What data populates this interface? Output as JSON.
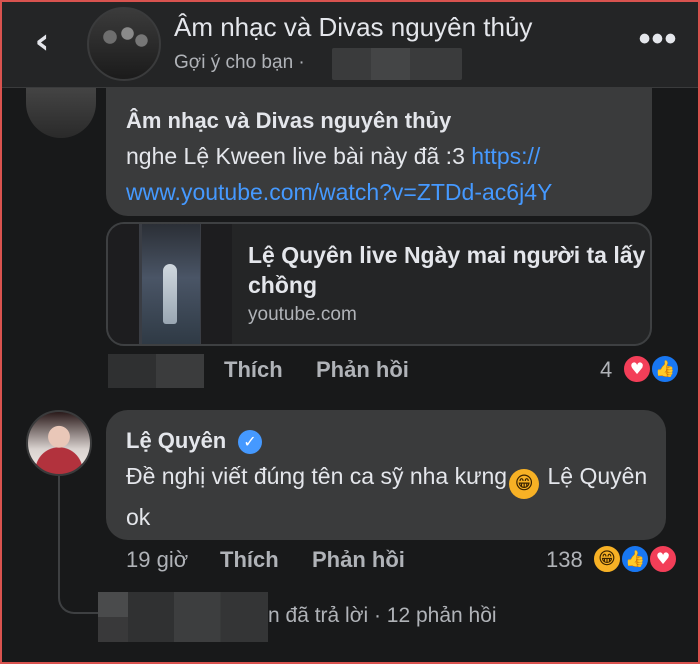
{
  "header": {
    "page_name": "Âm nhạc và Divas nguyên thủy",
    "subtitle": "Gợi ý cho bạn ·",
    "back_icon": "‹",
    "more_icon": "•••"
  },
  "comment1": {
    "author": "Âm nhạc và Divas nguyên thủy",
    "text_prefix": "nghe Lệ Kween live bài này đã :3 ",
    "link_line1": "https://",
    "link_line2": "www.youtube.com/watch?v=ZTDd-ac6j4Y",
    "card_title": "Lệ Quyên live Ngày mai người ta lấy chồng",
    "card_domain": "youtube.com",
    "like_label": "Thích",
    "reply_label": "Phản hồi",
    "reaction_count": "4"
  },
  "comment2": {
    "author": "Lệ Quyên",
    "text_before_emoji": "Đề nghị viết đúng tên ca sỹ nha kưng",
    "text_after_emoji": " Lệ Quyên ok",
    "timestamp": "19 giờ",
    "like_label": "Thích",
    "reply_label": "Phản hồi",
    "reaction_count": "138"
  },
  "replies": {
    "summary": "n đã trả lời · 12 phản hồi"
  },
  "icons": {
    "heart": "♥",
    "like": "👍",
    "haha": "😁",
    "verified": "✓"
  },
  "colors": {
    "background": "#18191a",
    "bubble": "#3a3b3c",
    "link": "#4599ff",
    "heart": "#f33e58",
    "like": "#1877f2"
  }
}
